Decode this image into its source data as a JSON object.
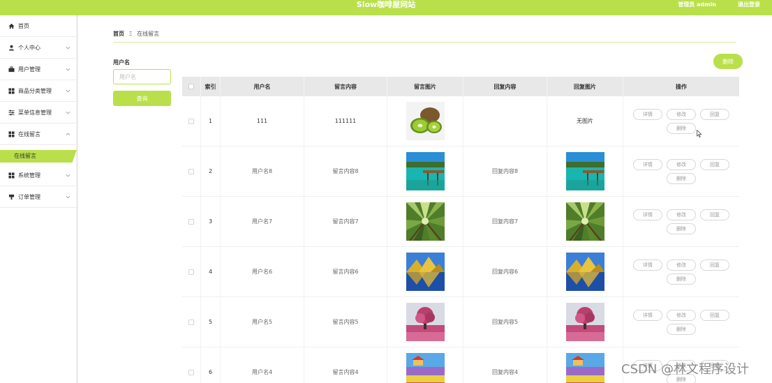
{
  "header": {
    "title": "Slow咖啡屋网站",
    "user": "管理员 admin",
    "logout": "退出登录"
  },
  "sidebar": {
    "items": [
      {
        "label": "首页",
        "icon": "home-icon",
        "chevron": false
      },
      {
        "label": "个人中心",
        "icon": "person-icon",
        "chevron": true
      },
      {
        "label": "用户管理",
        "icon": "briefcase-icon",
        "chevron": true
      },
      {
        "label": "商品分类管理",
        "icon": "grid-icon",
        "chevron": true
      },
      {
        "label": "菜单信息管理",
        "icon": "sliders-icon",
        "chevron": true
      },
      {
        "label": "在线留言",
        "icon": "grid-icon",
        "chevron": true,
        "expanded": true
      },
      {
        "label": "系统管理",
        "icon": "grid-icon",
        "chevron": true
      },
      {
        "label": "订单管理",
        "icon": "cup-icon",
        "chevron": true
      }
    ],
    "submenu_active": "在线留言"
  },
  "breadcrumb": {
    "home": "首页",
    "separator": "Ξ",
    "current": "在线留言"
  },
  "filter": {
    "label": "用户名",
    "placeholder": "用户名",
    "query_button": "查询"
  },
  "toolbar": {
    "delete_button": "删除"
  },
  "table": {
    "headers": [
      "索引",
      "用户名",
      "留言内容",
      "留言图片",
      "回复内容",
      "回复图片",
      "操作"
    ],
    "actions": [
      "详情",
      "修改",
      "回复",
      "删除"
    ],
    "rows": [
      {
        "index": "1",
        "username": "111",
        "content": "111111",
        "image": "kiwi",
        "reply": "",
        "reply_image": null,
        "reply_image_text": "无图片"
      },
      {
        "index": "2",
        "username": "用户名8",
        "content": "留言内容8",
        "image": "lake-dock",
        "reply": "回复内容8",
        "reply_image": "lake-dock"
      },
      {
        "index": "3",
        "username": "用户名7",
        "content": "留言内容7",
        "image": "forest",
        "reply": "回复内容7",
        "reply_image": "forest"
      },
      {
        "index": "4",
        "username": "用户名6",
        "content": "留言内容6",
        "image": "mountain-lake",
        "reply": "回复内容6",
        "reply_image": "mountain-lake"
      },
      {
        "index": "5",
        "username": "用户名5",
        "content": "留言内容5",
        "image": "pink-tree",
        "reply": "回复内容5",
        "reply_image": "pink-tree"
      },
      {
        "index": "6",
        "username": "用户名4",
        "content": "留言内容4",
        "image": "flower-field",
        "reply": "回复内容4",
        "reply_image": "flower-field"
      }
    ]
  },
  "watermark": "CSDN @林文程序设计",
  "colors": {
    "accent": "#b9e04a",
    "header_bg": "#e8e8e8"
  }
}
